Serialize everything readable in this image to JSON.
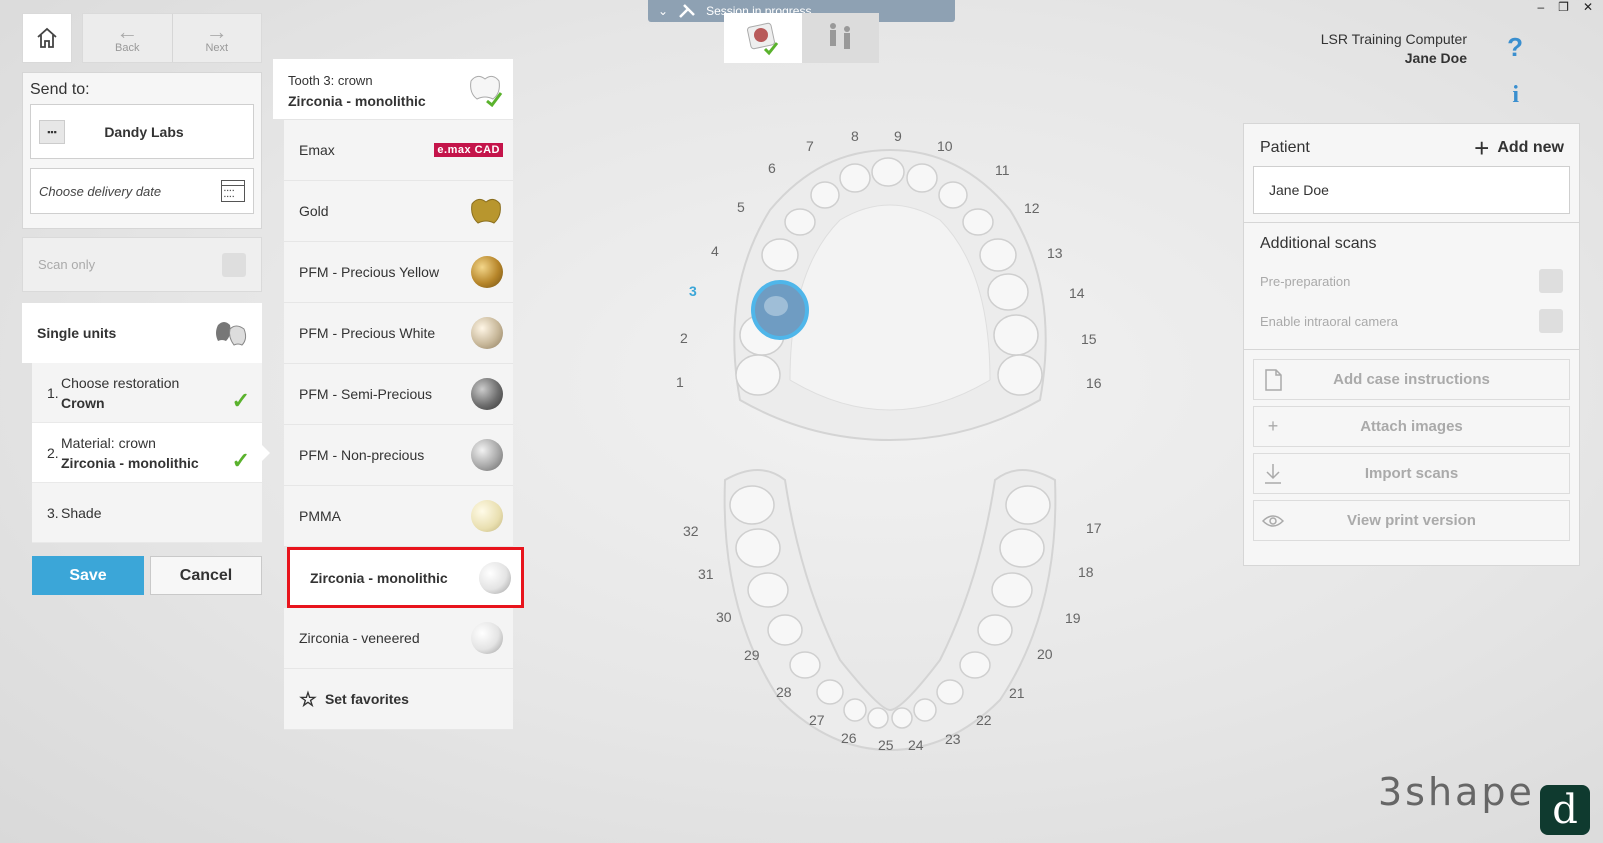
{
  "nav": {
    "back_label": "Back",
    "next_label": "Next"
  },
  "session": {
    "label": "Session in progress"
  },
  "window_controls": [
    "–",
    "❐",
    "✕"
  ],
  "user": {
    "computer": "LSR Training Computer",
    "name": "Jane Doe",
    "help_symbol": "?",
    "info_symbol": "i"
  },
  "send_to": {
    "label": "Send to:",
    "lab_name": "Dandy Labs",
    "delivery_placeholder": "Choose delivery date"
  },
  "scan_only": {
    "label": "Scan only"
  },
  "single_units": {
    "label": "Single units"
  },
  "steps": [
    {
      "num": "1.",
      "title": "Choose restoration",
      "value": "Crown",
      "done": true
    },
    {
      "num": "2.",
      "title": "Material: crown",
      "value": "Zirconia - monolithic",
      "done": true
    },
    {
      "num": "3.",
      "title": "Shade",
      "value": "",
      "done": false
    }
  ],
  "buttons": {
    "save": "Save",
    "cancel": "Cancel"
  },
  "tooth_header": {
    "title": "Tooth 3: crown",
    "material": "Zirconia - monolithic"
  },
  "materials": [
    {
      "label": "Emax",
      "icon": "emax-logo",
      "logo_text": "e.max CAD"
    },
    {
      "label": "Gold",
      "icon": "gold-crown-icon",
      "color": "#b8962e"
    },
    {
      "label": "PFM - Precious Yellow",
      "icon": "yellow-ball-icon",
      "color": "#b7862a"
    },
    {
      "label": "PFM - Precious White",
      "icon": "white-ball-icon",
      "color": "#c8b89a"
    },
    {
      "label": "PFM - Semi-Precious",
      "icon": "grey-ball-icon",
      "color": "#6e6e6e"
    },
    {
      "label": "PFM - Non-precious",
      "icon": "silver-ball-icon",
      "color": "#a9a9a9"
    },
    {
      "label": "PMMA",
      "icon": "cream-ball-icon",
      "color": "#e9dfb0"
    },
    {
      "label": "Zirconia - monolithic",
      "icon": "white-ball-icon",
      "color": "#f4f4f4",
      "selected": true
    },
    {
      "label": "Zirconia - veneered",
      "icon": "white-ball-icon",
      "color": "#f0f0f0"
    }
  ],
  "set_favorites": "Set favorites",
  "tooth_numbers": [
    "1",
    "2",
    "3",
    "4",
    "5",
    "6",
    "7",
    "8",
    "9",
    "10",
    "11",
    "12",
    "13",
    "14",
    "15",
    "16",
    "17",
    "18",
    "19",
    "20",
    "21",
    "22",
    "23",
    "24",
    "25",
    "26",
    "27",
    "28",
    "29",
    "30",
    "31",
    "32"
  ],
  "selected_tooth": "3",
  "patient": {
    "label": "Patient",
    "add_new": "Add new",
    "name": "Jane Doe"
  },
  "additional_scans": {
    "label": "Additional scans",
    "options": [
      "Pre-preparation",
      "Enable intraoral camera"
    ]
  },
  "actions": [
    {
      "label": "Add case instructions",
      "icon": "document-icon"
    },
    {
      "label": "Attach images",
      "icon": "plus-icon"
    },
    {
      "label": "Import scans",
      "icon": "download-icon"
    },
    {
      "label": "View print version",
      "icon": "eye-icon"
    }
  ],
  "brand": {
    "name": "3shape",
    "app_badge": "d"
  },
  "colors": {
    "accent": "#3ba6d8",
    "check": "#5ab22d",
    "selection_border": "#e8141c",
    "session_bar": "#8ea1b3"
  }
}
